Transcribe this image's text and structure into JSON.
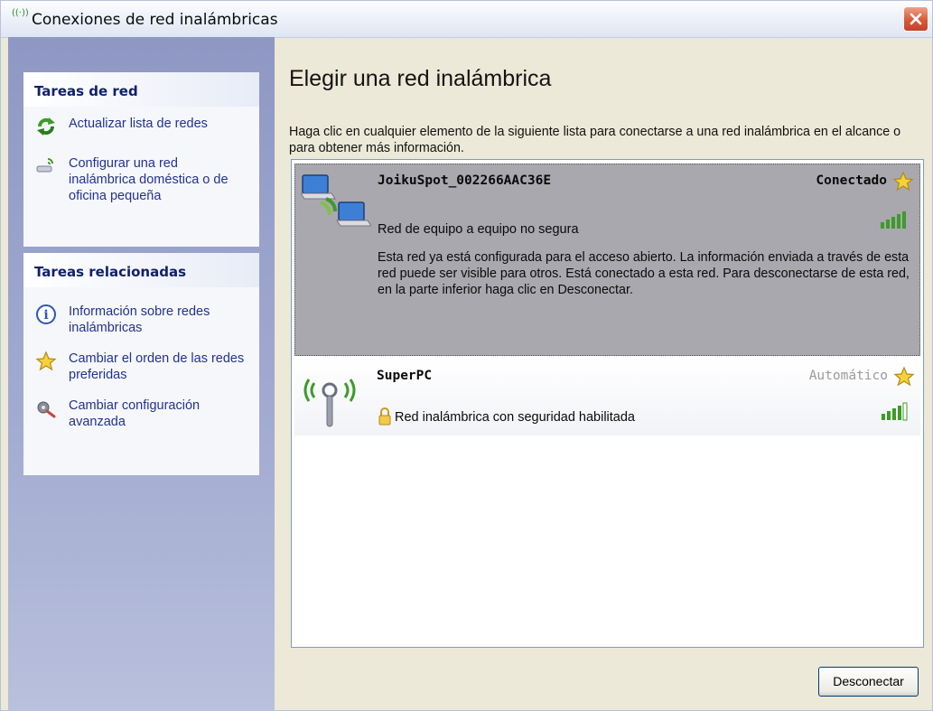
{
  "window": {
    "title": "Conexiones de red inalámbricas",
    "title_icon_glyph": "((·))",
    "close_label": "×"
  },
  "sidebar": {
    "network_tasks": {
      "header": "Tareas de red",
      "items": [
        {
          "label": "Actualizar lista de redes",
          "icon": "refresh-icon"
        },
        {
          "label": "Configurar una red inalámbrica doméstica o de oficina pequeña",
          "icon": "network-setup-icon"
        }
      ]
    },
    "related_tasks": {
      "header": "Tareas relacionadas",
      "items": [
        {
          "label": "Información sobre redes inalámbricas",
          "icon": "info-icon"
        },
        {
          "label": "Cambiar el orden de las redes preferidas",
          "icon": "star-icon"
        },
        {
          "label": "Cambiar configuración avanzada",
          "icon": "advanced-settings-icon"
        }
      ]
    }
  },
  "main": {
    "heading": "Elegir una red inalámbrica",
    "instructions": "Haga clic en cualquier elemento de la siguiente lista para conectarse a una red inalámbrica en el alcance o para obtener más información.",
    "networks": [
      {
        "name": "JoikuSpot_002266AAC36E",
        "status": "Conectado",
        "type": "Red de equipo a equipo no segura",
        "description": "Esta red ya está configurada para el acceso abierto. La información enviada a través de esta red puede ser visible para otros. Está conectado a esta red. Para desconectarse de esta red, en la parte inferior haga clic en Desconectar.",
        "signal_bars": 5,
        "selected": true,
        "icon": "adhoc-computers-icon"
      },
      {
        "name": "SuperPC",
        "status": "Automático",
        "type": "Red inalámbrica con seguridad habilitada",
        "signal_bars": 4,
        "selected": false,
        "icon": "wireless-antenna-icon"
      }
    ],
    "disconnect_button": "Desconectar"
  },
  "colors": {
    "accent_green": "#3d9b2a",
    "link_blue": "#22338d",
    "selected_bg": "#a9a8ae",
    "status_muted": "#9b9b9b"
  }
}
